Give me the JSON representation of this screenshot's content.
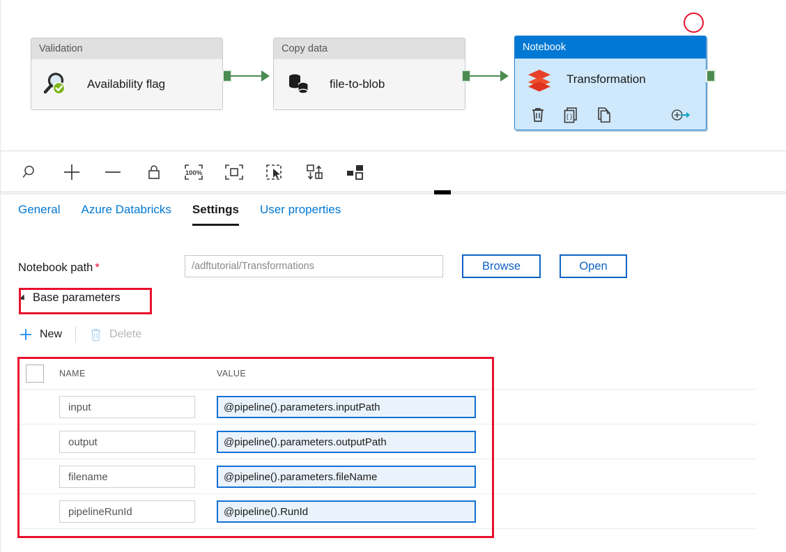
{
  "canvas": {
    "nodes": [
      {
        "id": "validation",
        "type_label": "Validation",
        "title": "Availability flag",
        "icon": "magnifier-check-icon",
        "selected": false
      },
      {
        "id": "copy-data",
        "type_label": "Copy data",
        "title": "file-to-blob",
        "icon": "database-copy-icon",
        "selected": false
      },
      {
        "id": "notebook",
        "type_label": "Notebook",
        "title": "Transformation",
        "icon": "databricks-stack-icon",
        "selected": true,
        "actions": [
          {
            "name": "delete",
            "icon": "trash-icon"
          },
          {
            "name": "code",
            "icon": "code-braces-icon"
          },
          {
            "name": "clone",
            "icon": "copy-pages-icon"
          },
          {
            "name": "add-output",
            "icon": "add-arrow-icon"
          }
        ]
      }
    ],
    "selection_accent": "#0078d4",
    "connector_color": "#4b8b50",
    "annotation_color": "#e8112d"
  },
  "toolbar": {
    "buttons": [
      {
        "name": "zoom-search",
        "icon": "magnifier-icon",
        "label": "Search"
      },
      {
        "name": "zoom-in",
        "icon": "plus-icon",
        "label": "Zoom in"
      },
      {
        "name": "zoom-out",
        "icon": "minus-icon",
        "label": "Zoom out"
      },
      {
        "name": "lock",
        "icon": "lock-icon",
        "label": "Lock"
      },
      {
        "name": "zoom-100",
        "icon": "zoom-100-icon",
        "label": "100%"
      },
      {
        "name": "zoom-to-fit",
        "icon": "fit-icon",
        "label": "Zoom to fit"
      },
      {
        "name": "select-mode",
        "icon": "marquee-cursor-icon",
        "label": "Select"
      },
      {
        "name": "auto-align",
        "icon": "align-icon",
        "label": "Auto align"
      },
      {
        "name": "layout",
        "icon": "layout-icon",
        "label": "Layout"
      }
    ],
    "zoom_level": "100%"
  },
  "tabs": [
    {
      "id": "general",
      "label": "General",
      "active": false
    },
    {
      "id": "azure-databricks",
      "label": "Azure Databricks",
      "active": false
    },
    {
      "id": "settings",
      "label": "Settings",
      "active": true
    },
    {
      "id": "user-properties",
      "label": "User properties",
      "active": false
    }
  ],
  "settings": {
    "notebook_path": {
      "label": "Notebook path",
      "required_marker": "*",
      "value": "/adftutorial/Transformations",
      "placeholder": "/adftutorial/Transformations"
    },
    "browse_button": "Browse",
    "open_button": "Open",
    "base_parameters": {
      "section_label": "Base parameters",
      "expanded": true,
      "new_label": "New",
      "delete_label": "Delete",
      "delete_enabled": false,
      "columns": [
        "NAME",
        "VALUE"
      ],
      "rows": [
        {
          "name": "input",
          "value": "@pipeline().parameters.inputPath"
        },
        {
          "name": "output",
          "value": "@pipeline().parameters.outputPath"
        },
        {
          "name": "filename",
          "value": "@pipeline().parameters.fileName"
        },
        {
          "name": "pipelineRunId",
          "value": "@pipeline().RunId"
        }
      ]
    }
  }
}
